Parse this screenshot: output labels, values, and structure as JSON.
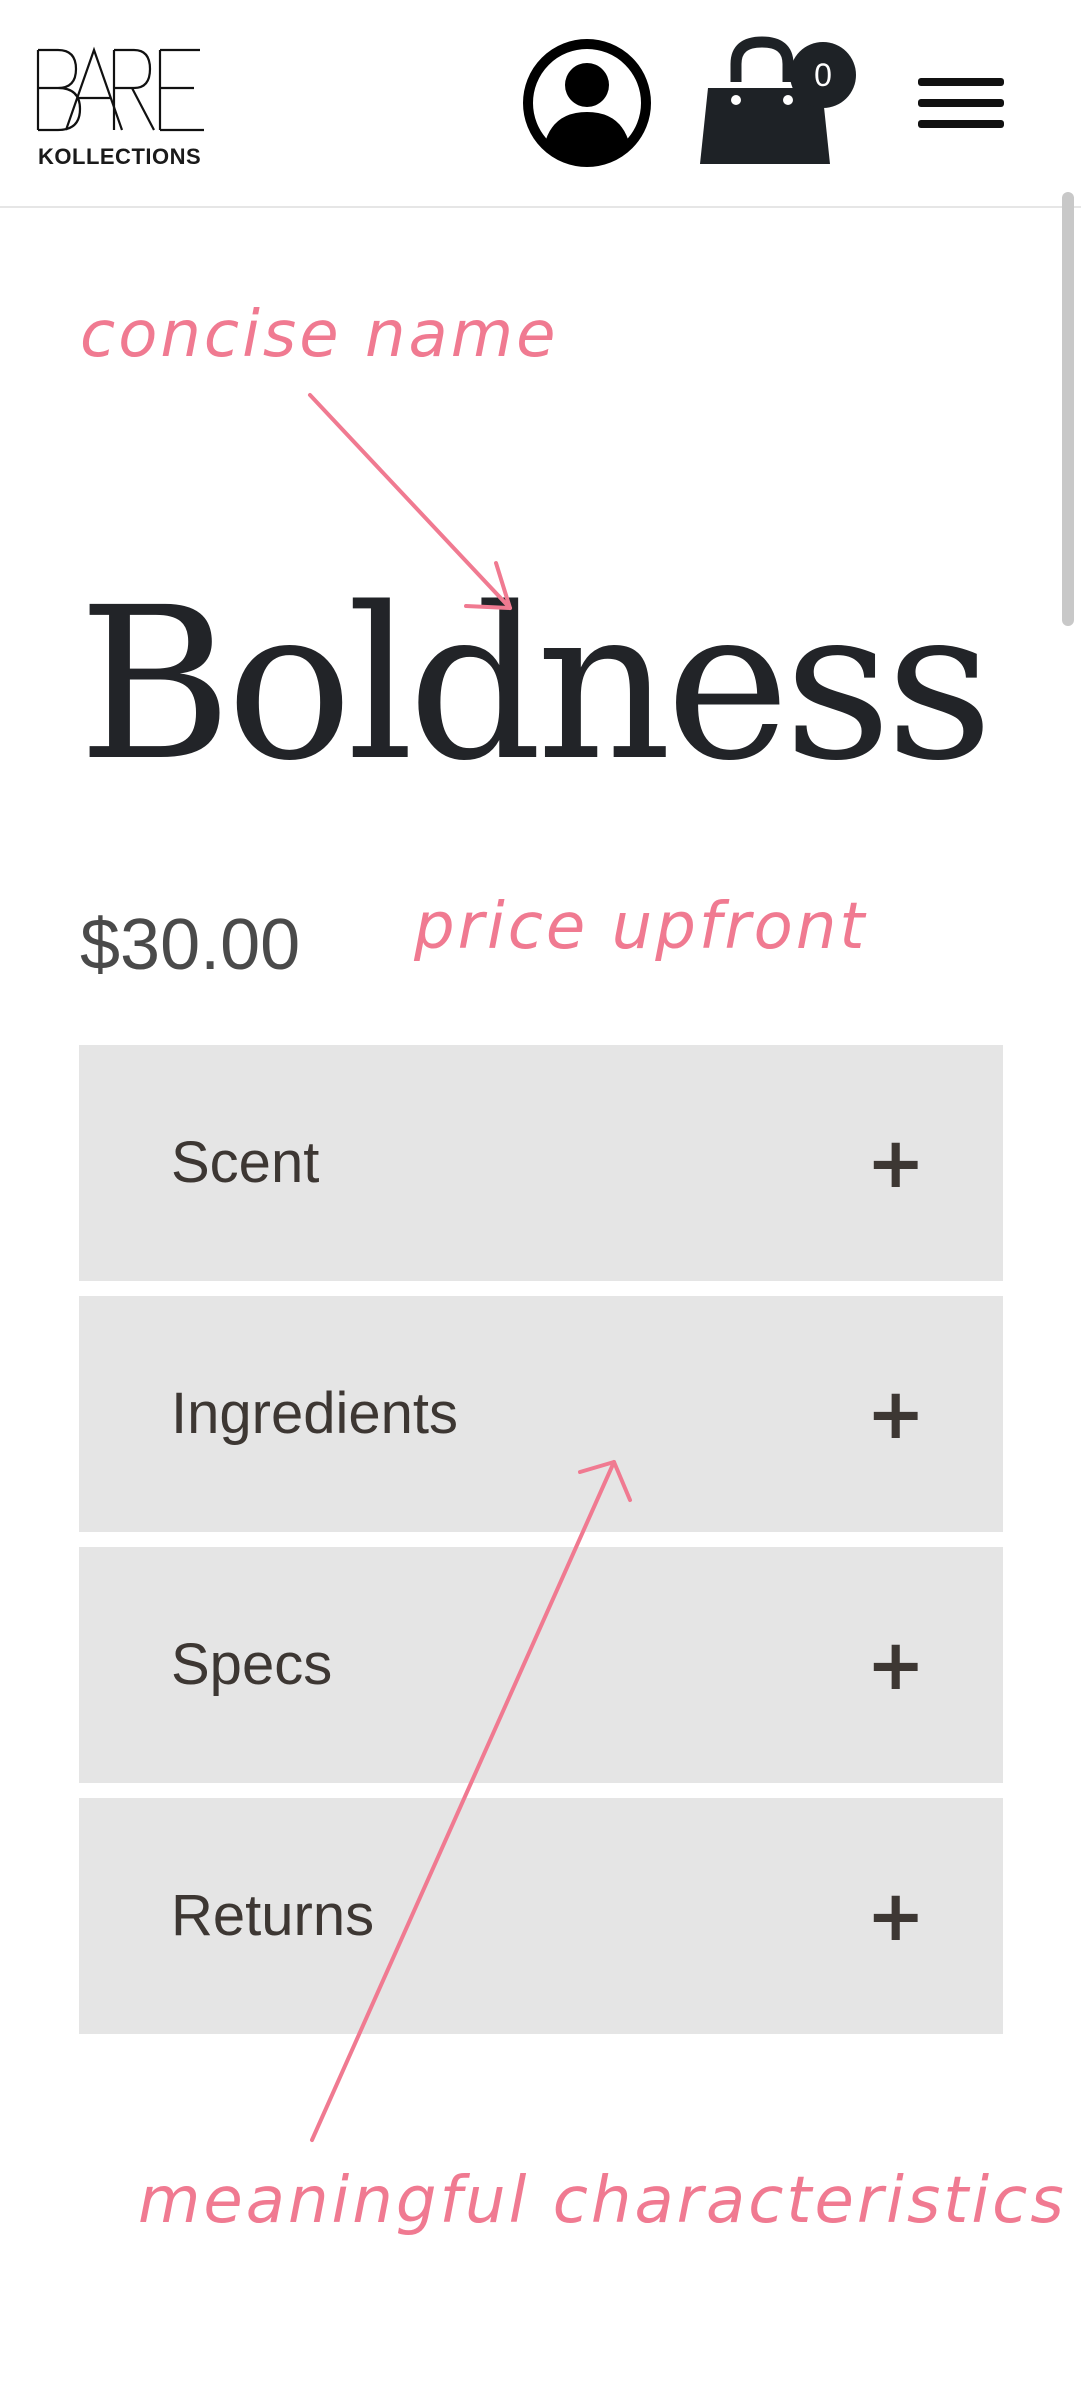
{
  "header": {
    "logo_text": "BARE",
    "logo_subtext": "KOLLECTIONS",
    "account_icon": "user-circle-icon",
    "cart_icon": "shopping-bag-icon",
    "cart_count": "0",
    "menu_icon": "hamburger-menu-icon"
  },
  "product": {
    "name": "Boldness",
    "price": "$30.00"
  },
  "accordion": {
    "items": [
      {
        "label": "Scent",
        "icon": "plus-icon"
      },
      {
        "label": "Ingredients",
        "icon": "plus-icon"
      },
      {
        "label": "Specs",
        "icon": "plus-icon"
      },
      {
        "label": "Returns",
        "icon": "plus-icon"
      }
    ],
    "expand_symbol": "+"
  },
  "annotations": {
    "name_note": "concise name",
    "price_note": "price upfront",
    "characteristics_note": "meaningful characteristics"
  },
  "colors": {
    "annotation": "#f07a91",
    "accordion_bg": "#e5e5e5",
    "text_dark": "#222428",
    "cart_badge": "#1e2226"
  }
}
